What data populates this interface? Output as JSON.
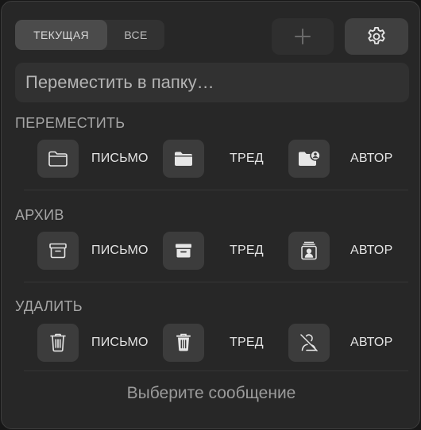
{
  "tabs": {
    "current": "ТЕКУЩАЯ",
    "all": "ВСЕ"
  },
  "toolbar": {
    "add_icon": "plus-icon",
    "settings_icon": "gear-icon"
  },
  "search": {
    "placeholder": "Переместить в папку…",
    "value": ""
  },
  "sections": {
    "move": {
      "title": "ПЕРЕМЕСТИТЬ",
      "actions": [
        {
          "label": "ПИСЬМО",
          "icon": "folder-outline-icon"
        },
        {
          "label": "ТРЕД",
          "icon": "folder-filled-icon"
        },
        {
          "label": "АВТОР",
          "icon": "folder-person-icon"
        }
      ]
    },
    "archive": {
      "title": "АРХИВ",
      "actions": [
        {
          "label": "ПИСЬМО",
          "icon": "archive-box-outline-icon"
        },
        {
          "label": "ТРЕД",
          "icon": "archive-box-filled-icon"
        },
        {
          "label": "АВТОР",
          "icon": "archive-person-icon"
        }
      ]
    },
    "delete": {
      "title": "УДАЛИТЬ",
      "actions": [
        {
          "label": "ПИСЬМО",
          "icon": "trash-outline-icon"
        },
        {
          "label": "ТРЕД",
          "icon": "trash-filled-icon"
        },
        {
          "label": "АВТОР",
          "icon": "person-slash-icon"
        }
      ]
    }
  },
  "footer": {
    "status": "Выберите сообщение"
  }
}
